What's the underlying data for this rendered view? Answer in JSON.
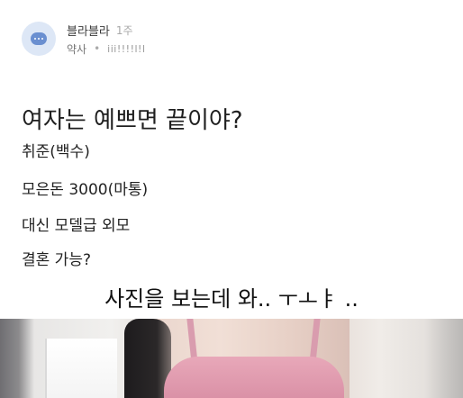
{
  "post": {
    "author": {
      "name": "블라블라",
      "time": "1주",
      "category": "약사",
      "separator": "•",
      "company": "iii!!!!l!l"
    },
    "title": "여자는 예쁘면 끝이야?",
    "body": [
      "취준(백수)",
      "모은돈 3000(마통)",
      "대신 모델급 외모",
      "결혼 가능?"
    ]
  },
  "overlay": {
    "caption": "사진을 보는데 와.. ㅜㅗㅑ .."
  },
  "icons": {
    "avatar": "chat-bubble-icon"
  },
  "colors": {
    "avatar_background": "#dde7f6",
    "avatar_icon": "#6a8fd0",
    "title_text": "#1f1f1f",
    "meta_text": "#7b7b7b",
    "photo_accent": "#d98fa5"
  }
}
